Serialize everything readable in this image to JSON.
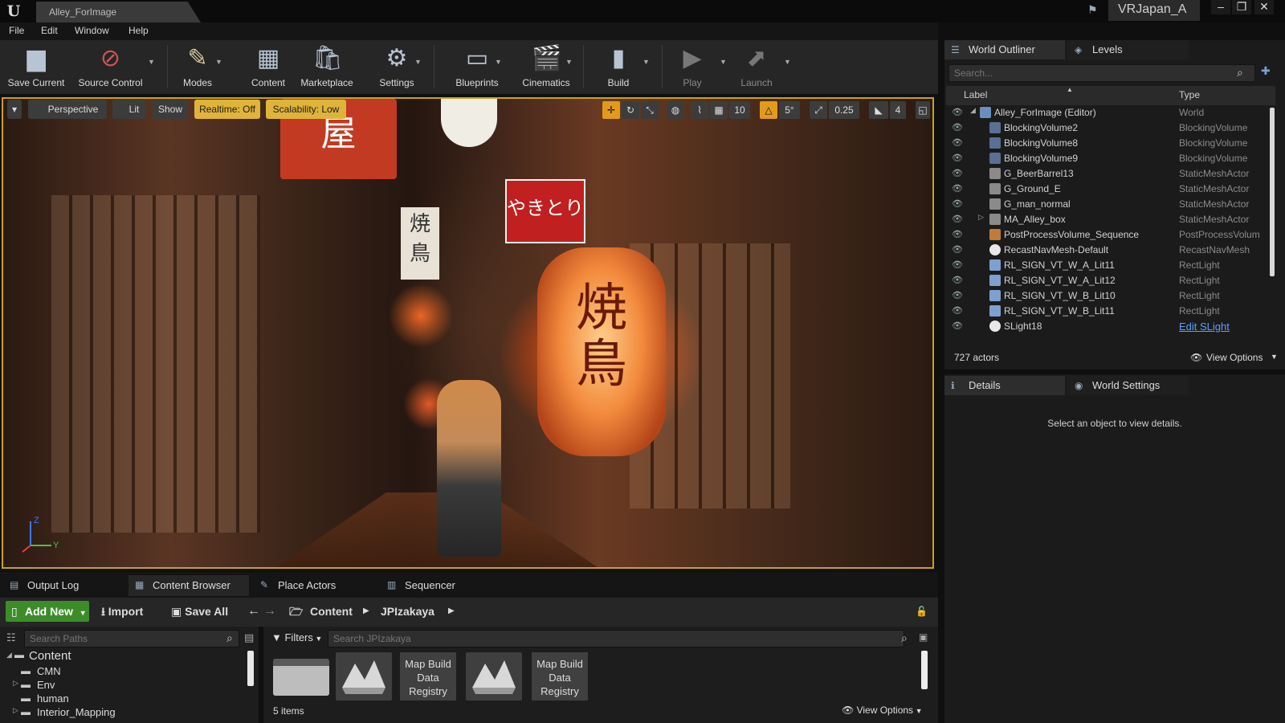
{
  "app": {
    "logo": "U",
    "document_tab": "Alley_ForImage",
    "project_name": "VRJapan_A",
    "window_controls": [
      "–",
      "❐",
      "✕"
    ]
  },
  "menu": [
    "File",
    "Edit",
    "Window",
    "Help"
  ],
  "toolbar": {
    "save_current": "Save Current",
    "source_control": "Source Control",
    "modes": "Modes",
    "content": "Content",
    "marketplace": "Marketplace",
    "settings": "Settings",
    "blueprints": "Blueprints",
    "cinematics": "Cinematics",
    "build": "Build",
    "play": "Play",
    "launch": "Launch"
  },
  "viewport": {
    "perspective": "Perspective",
    "lit": "Lit",
    "show": "Show",
    "realtime": "Realtime: Off",
    "scalability": "Scalability: Low",
    "grid_snap": "10",
    "rotation_snap": "5°",
    "scale_snap": "0.25",
    "camera_speed": "4",
    "axis_z": "Z",
    "axis_y": "Y"
  },
  "outliner": {
    "tab_world_outliner": "World Outliner",
    "tab_levels": "Levels",
    "search_placeholder": "Search...",
    "col_label": "Label",
    "col_type": "Type",
    "rows": [
      {
        "label": "Alley_ForImage (Editor)",
        "type": "World"
      },
      {
        "label": "BlockingVolume2",
        "type": "BlockingVolume"
      },
      {
        "label": "BlockingVolume8",
        "type": "BlockingVolume"
      },
      {
        "label": "BlockingVolume9",
        "type": "BlockingVolume"
      },
      {
        "label": "G_BeerBarrel13",
        "type": "StaticMeshActor"
      },
      {
        "label": "G_Ground_E",
        "type": "StaticMeshActor"
      },
      {
        "label": "G_man_normal",
        "type": "StaticMeshActor"
      },
      {
        "label": "MA_Alley_box",
        "type": "StaticMeshActor"
      },
      {
        "label": "PostProcessVolume_Sequence",
        "type": "PostProcessVolum"
      },
      {
        "label": "RecastNavMesh-Default",
        "type": "RecastNavMesh"
      },
      {
        "label": "RL_SIGN_VT_W_A_Lit11",
        "type": "RectLight"
      },
      {
        "label": "RL_SIGN_VT_W_A_Lit12",
        "type": "RectLight"
      },
      {
        "label": "RL_SIGN_VT_W_B_Lit10",
        "type": "RectLight"
      },
      {
        "label": "RL_SIGN_VT_W_B_Lit11",
        "type": "RectLight"
      },
      {
        "label": "SLight18",
        "type": "Edit SLight"
      }
    ],
    "actor_count": "727 actors",
    "view_options": "View Options"
  },
  "details": {
    "tab_details": "Details",
    "tab_world_settings": "World Settings",
    "empty_message": "Select an object to view details."
  },
  "bottom_tabs": {
    "output_log": "Output Log",
    "content_browser": "Content Browser",
    "place_actors": "Place Actors",
    "sequencer": "Sequencer"
  },
  "content_browser": {
    "add_new": "Add New",
    "import": "Import",
    "save_all": "Save All",
    "path_root": "Content",
    "path_folder": "JPIzakaya",
    "search_paths_placeholder": "Search Paths",
    "filters": "Filters",
    "search_assets_placeholder": "Search JPIzakaya",
    "tree": [
      "Content",
      "CMN",
      "Env",
      "human",
      "Interior_Mapping"
    ],
    "asset_text_1": "Map Build Data Registry",
    "asset_text_2": "Map Build Data Registry",
    "items_count": "5 items",
    "view_options": "View Options"
  },
  "colors": {
    "accent_yellow": "#e0b43a",
    "add_new_green": "#3c8d2a",
    "link_blue": "#5aa0ff"
  }
}
